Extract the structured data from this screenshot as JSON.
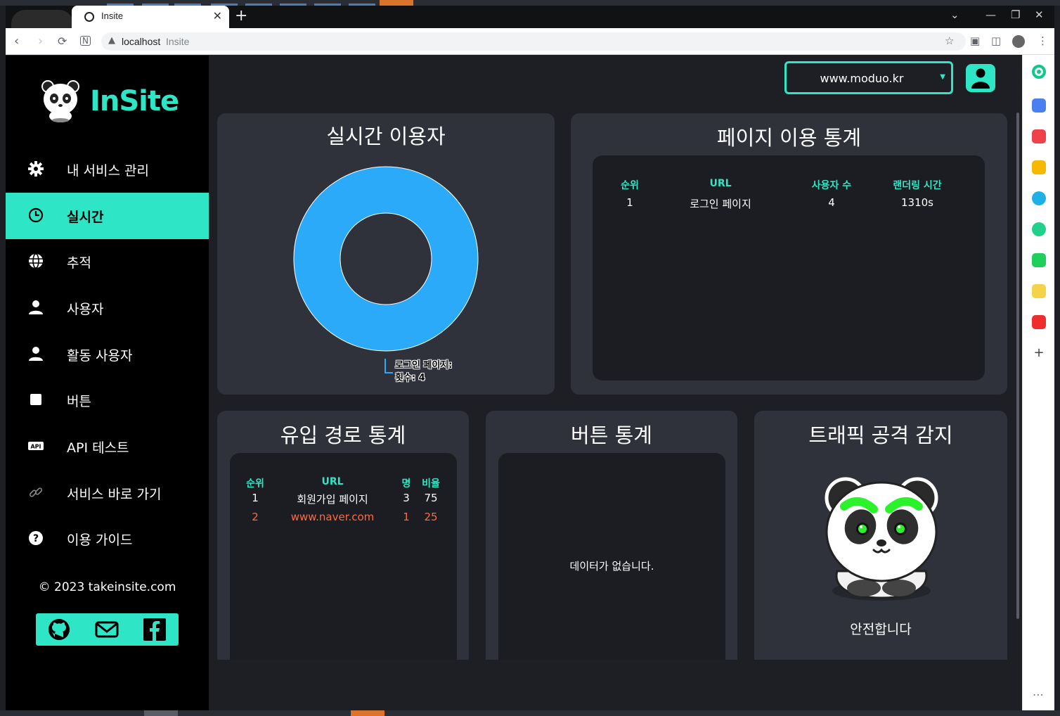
{
  "browser": {
    "tab_title": "Insite",
    "tab_close": "✕",
    "new_tab": "+",
    "url_host": "localhost",
    "url_path": "Insite",
    "window_controls": [
      "⌄",
      "—",
      "❐",
      "✕"
    ]
  },
  "sidebar": {
    "brand": "InSite",
    "items": [
      {
        "label": "내 서비스 관리",
        "icon": "gear-icon"
      },
      {
        "label": "실시간",
        "icon": "clock-icon",
        "active": true
      },
      {
        "label": "추적",
        "icon": "globe-icon"
      },
      {
        "label": "사용자",
        "icon": "user-icon"
      },
      {
        "label": "활동 사용자",
        "icon": "user-icon"
      },
      {
        "label": "버튼",
        "icon": "square-icon"
      },
      {
        "label": "API 테스트",
        "icon": "api-icon"
      },
      {
        "label": "서비스 바로 가기",
        "icon": "link-icon"
      },
      {
        "label": "이용 가이드",
        "icon": "help-icon"
      }
    ],
    "copyright": "© 2023 takeinsite.com",
    "social": [
      "github-icon",
      "mail-icon",
      "facebook-icon"
    ]
  },
  "header": {
    "site_select_value": "www.moduo.kr",
    "site_select_arrow": "▼"
  },
  "realtime": {
    "title": "실시간 이용자",
    "tooltip_line1": "로그인 페이지:",
    "tooltip_line2": "횟수: 4"
  },
  "chart_data": {
    "type": "pie",
    "categories": [
      "로그인 페이지"
    ],
    "values": [
      4
    ],
    "colors": [
      "#2aaaf9"
    ]
  },
  "page_stats": {
    "title": "페이지 이용 통계",
    "headers": [
      "순위",
      "URL",
      "사용자 수",
      "랜더링 시간"
    ],
    "rows": [
      [
        "1",
        "로그인 페이지",
        "4",
        "1310s"
      ]
    ]
  },
  "referrer_stats": {
    "title": "유입 경로 통계",
    "headers": [
      "순위",
      "URL",
      "명",
      "비율"
    ],
    "rows": [
      [
        "1",
        "회원가입 페이지",
        "3",
        "75"
      ],
      [
        "2",
        "www.naver.com",
        "1",
        "25"
      ]
    ]
  },
  "button_stats": {
    "title": "버튼 통계",
    "empty_message": "데이터가 없습니다."
  },
  "traffic": {
    "title": "트래픽 공격 감지",
    "status": "안전합니다"
  },
  "colors": {
    "accent": "#2ee6c6",
    "highlight_row": "#ff6a3d",
    "donut": "#2aaaf9"
  }
}
